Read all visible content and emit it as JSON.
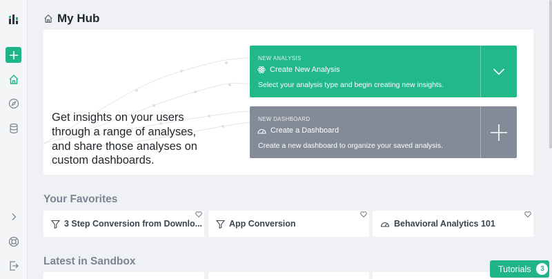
{
  "header": {
    "title": "My Hub"
  },
  "hero": {
    "text": "Get insights on your users through a range of analyses, and share those analyses on custom dashboards.",
    "analysis": {
      "kicker": "NEW ANALYSIS",
      "title": "Create New Analysis",
      "description": "Select your analysis type and begin creating new insights."
    },
    "dashboard": {
      "kicker": "NEW DASHBOARD",
      "title": "Create a Dashboard",
      "description": "Create a new dashboard to organize your saved analysis."
    }
  },
  "favorites": {
    "title": "Your Favorites",
    "items": [
      {
        "label": "3 Step Conversion from Downlo...",
        "icon": "funnel-icon"
      },
      {
        "label": "App Conversion",
        "icon": "funnel-icon"
      },
      {
        "label": "Behavioral Analytics 101",
        "icon": "dashboard-icon"
      }
    ]
  },
  "sandbox": {
    "title": "Latest in Sandbox"
  },
  "tutorials": {
    "label": "Tutorials",
    "count": "3"
  },
  "colors": {
    "accent": "#1fb589",
    "analysis_card": "#21b88a",
    "dashboard_card": "#838b98"
  }
}
